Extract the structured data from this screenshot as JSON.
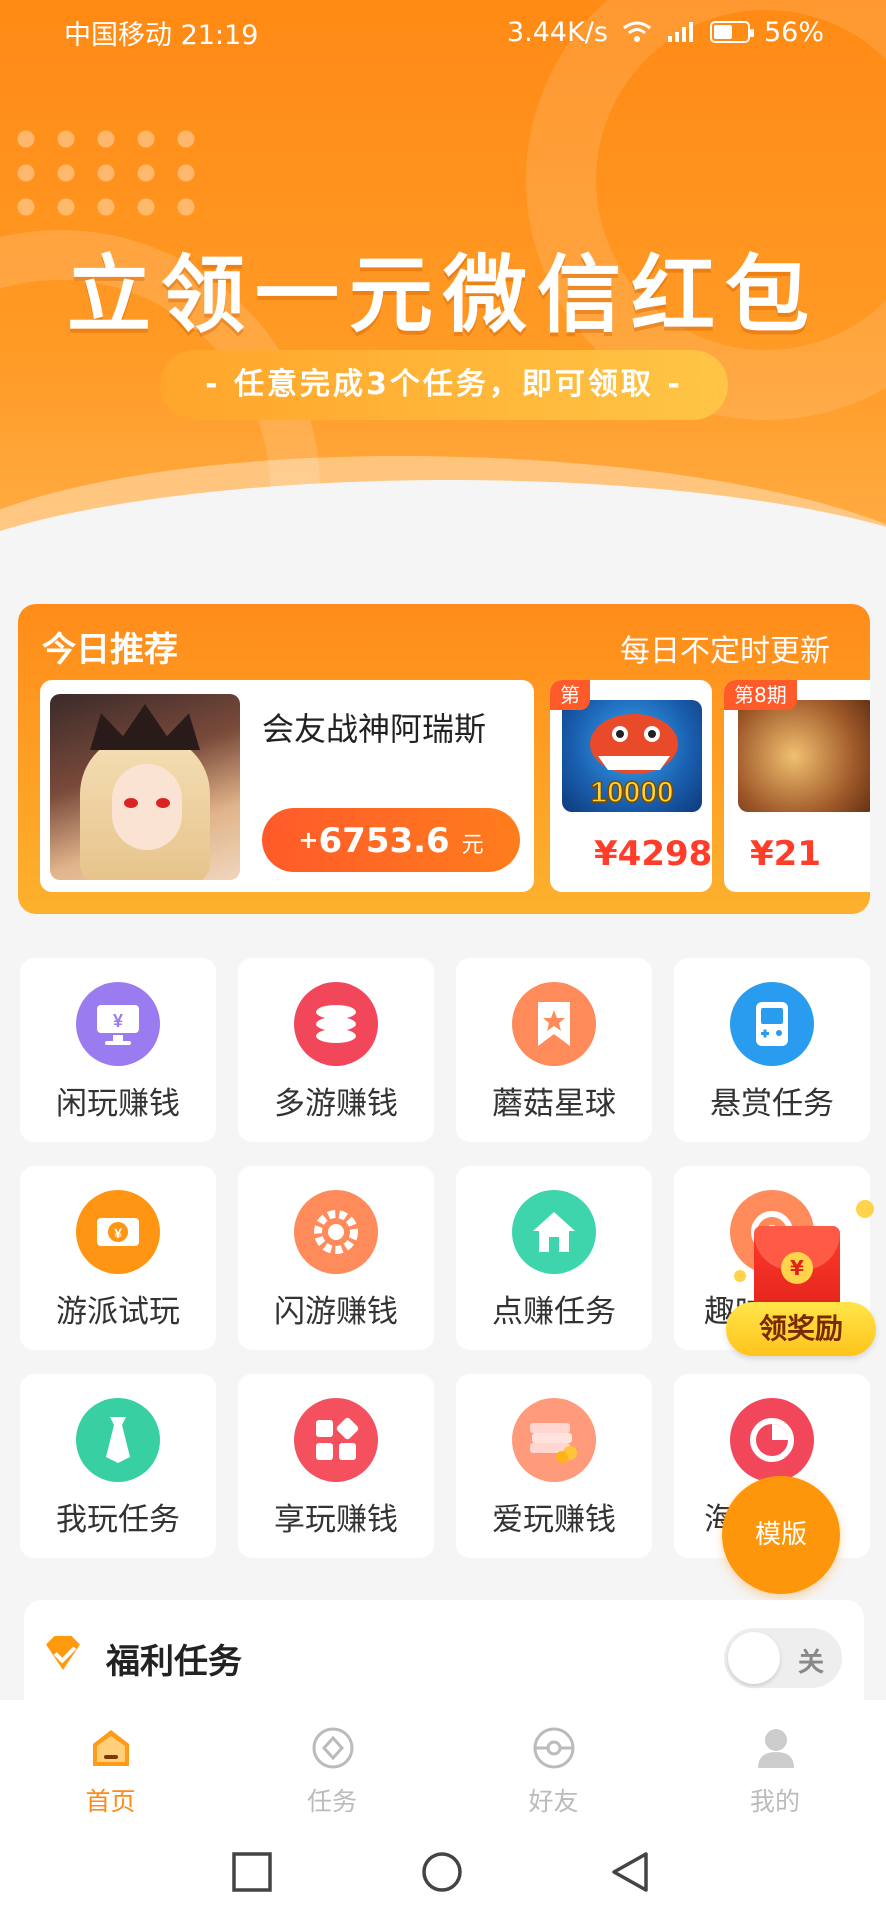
{
  "status": {
    "carrier_time": "中国移动 21:19",
    "speed": "3.44K/s",
    "battery": "56%"
  },
  "banner": {
    "title": "立领一元微信红包",
    "subtitle": "- 任意完成3个任务，即可领取 -"
  },
  "recommend": {
    "title": "今日推荐",
    "note": "每日不定时更新",
    "main": {
      "name": "会友战神阿瑞斯",
      "reward_plus": "+",
      "reward": "6753.6",
      "reward_unit": "元"
    },
    "cards": [
      {
        "tag": "第",
        "price": "¥4298",
        "thumb_text": "10000"
      },
      {
        "tag": "第8期",
        "price": "¥21"
      }
    ]
  },
  "grid": [
    {
      "label": "闲玩赚钱",
      "icon": "tv-yen-icon",
      "color": "#9b7bf0"
    },
    {
      "label": "多游赚钱",
      "icon": "coins-stack-icon",
      "color": "#f2475a"
    },
    {
      "label": "蘑菇星球",
      "icon": "bookmark-star-icon",
      "color": "#ff8a5a"
    },
    {
      "label": "悬赏任务",
      "icon": "gamepad-icon",
      "color": "#2a9cf0"
    },
    {
      "label": "游派试玩",
      "icon": "yen-card-icon",
      "color": "#ff9512"
    },
    {
      "label": "闪游赚钱",
      "icon": "ring-icon",
      "color": "#ff8a5a"
    },
    {
      "label": "点赚任务",
      "icon": "house-broom-icon",
      "color": "#3ed5ad"
    },
    {
      "label": "趣味",
      "icon": "target-icon",
      "color": "#ff8a5a"
    },
    {
      "label": "我玩任务",
      "icon": "tie-icon",
      "color": "#38cfa2"
    },
    {
      "label": "享玩赚钱",
      "icon": "apps-icon",
      "color": "#f5505d"
    },
    {
      "label": "爱玩赚钱",
      "icon": "money-stack-icon",
      "color": "#ff9a7a"
    },
    {
      "label": "海",
      "icon": "pie-chart-icon",
      "color": "#f2475a"
    }
  ],
  "floating": {
    "claim_label": "领奖励",
    "coin_symbol": "¥",
    "template_label": "模版"
  },
  "welfare": {
    "title": "福利任务",
    "toggle_label": "关"
  },
  "nav": [
    {
      "label": "首页",
      "icon": "home-icon"
    },
    {
      "label": "任务",
      "icon": "task-diamond-icon"
    },
    {
      "label": "好友",
      "icon": "friends-icon"
    },
    {
      "label": "我的",
      "icon": "profile-icon"
    }
  ]
}
